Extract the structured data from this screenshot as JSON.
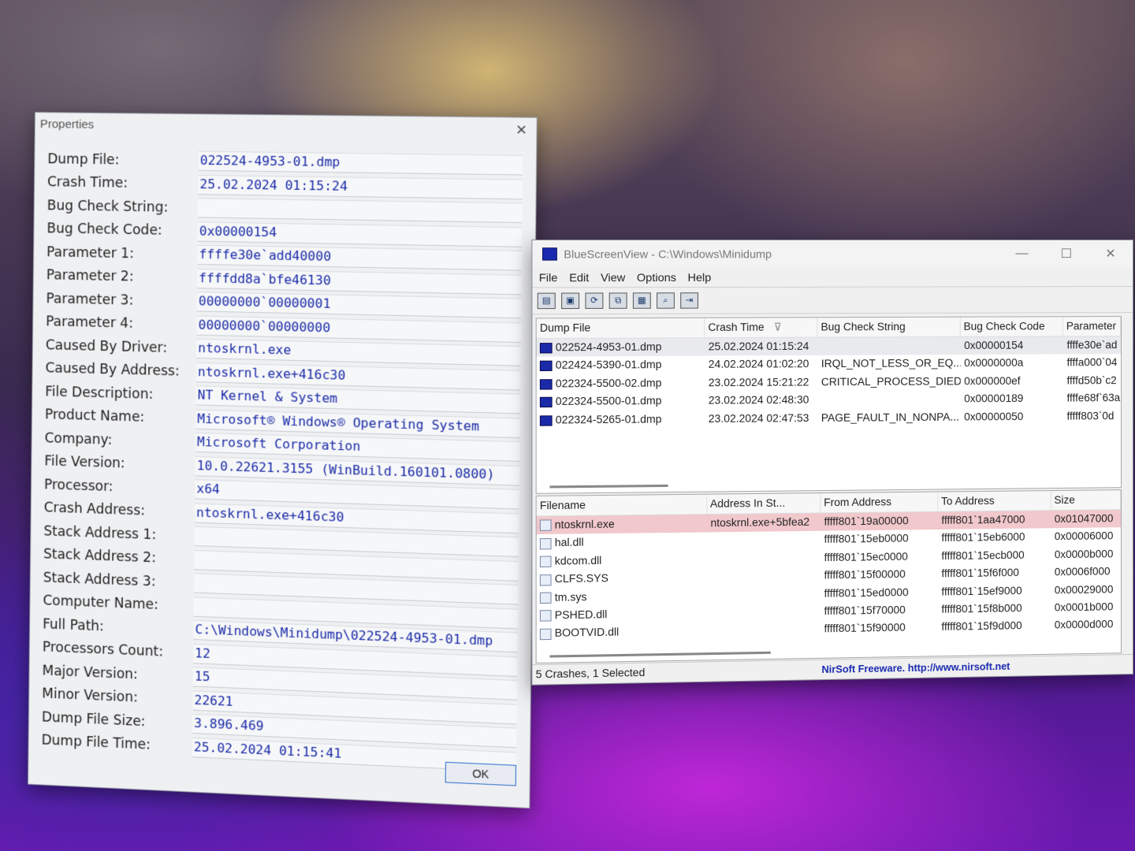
{
  "properties": {
    "title": "Properties",
    "close_glyph": "×",
    "ok_label": "OK",
    "rows": [
      {
        "label": "Dump File:",
        "value": "022524-4953-01.dmp"
      },
      {
        "label": "Crash Time:",
        "value": "25.02.2024 01:15:24"
      },
      {
        "label": "Bug Check String:",
        "value": ""
      },
      {
        "label": "Bug Check Code:",
        "value": "0x00000154"
      },
      {
        "label": "Parameter 1:",
        "value": "ffffe30e`add40000"
      },
      {
        "label": "Parameter 2:",
        "value": "ffffdd8a`bfe46130"
      },
      {
        "label": "Parameter 3:",
        "value": "00000000`00000001"
      },
      {
        "label": "Parameter 4:",
        "value": "00000000`00000000"
      },
      {
        "label": "Caused By Driver:",
        "value": "ntoskrnl.exe"
      },
      {
        "label": "Caused By Address:",
        "value": "ntoskrnl.exe+416c30"
      },
      {
        "label": "File Description:",
        "value": "NT Kernel & System"
      },
      {
        "label": "Product Name:",
        "value": "Microsoft® Windows® Operating System"
      },
      {
        "label": "Company:",
        "value": "Microsoft Corporation"
      },
      {
        "label": "File Version:",
        "value": "10.0.22621.3155 (WinBuild.160101.0800)"
      },
      {
        "label": "Processor:",
        "value": "x64"
      },
      {
        "label": "Crash Address:",
        "value": "ntoskrnl.exe+416c30"
      },
      {
        "label": "Stack Address 1:",
        "value": ""
      },
      {
        "label": "Stack Address 2:",
        "value": ""
      },
      {
        "label": "Stack Address 3:",
        "value": ""
      },
      {
        "label": "Computer Name:",
        "value": ""
      },
      {
        "label": "Full Path:",
        "value": "C:\\Windows\\Minidump\\022524-4953-01.dmp"
      },
      {
        "label": "Processors Count:",
        "value": "12"
      },
      {
        "label": "Major Version:",
        "value": "15"
      },
      {
        "label": "Minor Version:",
        "value": "22621"
      },
      {
        "label": "Dump File Size:",
        "value": "3.896.469"
      },
      {
        "label": "Dump File Time:",
        "value": "25.02.2024 01:15:41"
      }
    ]
  },
  "bluescreenview": {
    "app_name": "BlueScreenView",
    "title_sep": " - ",
    "title_path": "C:\\Windows\\Minidump",
    "window_buttons": {
      "minimize": "—",
      "maximize": "☐",
      "close": "✕"
    },
    "menu": [
      "File",
      "Edit",
      "View",
      "Options",
      "Help"
    ],
    "toolbar_icons": [
      "properties-icon",
      "save-icon",
      "refresh-icon",
      "copy-icon",
      "report-icon",
      "find-icon",
      "exit-icon"
    ],
    "toolbar_glyphs": [
      "▤",
      "▣",
      "⟳",
      "⧉",
      "▦",
      "⌕",
      "⇥"
    ],
    "crash_columns": [
      "Dump File",
      "Crash Time",
      "Bug Check String",
      "Bug Check Code",
      "Parameter"
    ],
    "sort_glyph": "⊽",
    "crashes": [
      {
        "dump": "022524-4953-01.dmp",
        "time": "25.02.2024 01:15:24",
        "string": "",
        "code": "0x00000154",
        "param": "ffffe30e`ad"
      },
      {
        "dump": "022424-5390-01.dmp",
        "time": "24.02.2024 01:02:20",
        "string": "IRQL_NOT_LESS_OR_EQ...",
        "code": "0x0000000a",
        "param": "ffffa000`04"
      },
      {
        "dump": "022324-5500-02.dmp",
        "time": "23.02.2024 15:21:22",
        "string": "CRITICAL_PROCESS_DIED",
        "code": "0x000000ef",
        "param": "ffffd50b`c2"
      },
      {
        "dump": "022324-5500-01.dmp",
        "time": "23.02.2024 02:48:30",
        "string": "",
        "code": "0x00000189",
        "param": "ffffe68f`63a"
      },
      {
        "dump": "022324-5265-01.dmp",
        "time": "23.02.2024 02:47:53",
        "string": "PAGE_FAULT_IN_NONPA...",
        "code": "0x00000050",
        "param": "fffff803`0d"
      }
    ],
    "driver_columns": [
      "Filename",
      "Address In St...",
      "From Address",
      "To Address",
      "Size"
    ],
    "drivers": [
      {
        "file": "ntoskrnl.exe",
        "addr": "ntoskrnl.exe+5bfea2",
        "from": "fffff801`19a00000",
        "to": "fffff801`1aa47000",
        "size": "0x01047000"
      },
      {
        "file": "hal.dll",
        "addr": "",
        "from": "fffff801`15eb0000",
        "to": "fffff801`15eb6000",
        "size": "0x00006000"
      },
      {
        "file": "kdcom.dll",
        "addr": "",
        "from": "fffff801`15ec0000",
        "to": "fffff801`15ecb000",
        "size": "0x0000b000"
      },
      {
        "file": "CLFS.SYS",
        "addr": "",
        "from": "fffff801`15f00000",
        "to": "fffff801`15f6f000",
        "size": "0x0006f000"
      },
      {
        "file": "tm.sys",
        "addr": "",
        "from": "fffff801`15ed0000",
        "to": "fffff801`15ef9000",
        "size": "0x00029000"
      },
      {
        "file": "PSHED.dll",
        "addr": "",
        "from": "fffff801`15f70000",
        "to": "fffff801`15f8b000",
        "size": "0x0001b000"
      },
      {
        "file": "BOOTVID.dll",
        "addr": "",
        "from": "fffff801`15f90000",
        "to": "fffff801`15f9d000",
        "size": "0x0000d000"
      }
    ],
    "status_left": "5 Crashes, 1 Selected",
    "status_right": "NirSoft Freeware.  http://www.nirsoft.net"
  }
}
